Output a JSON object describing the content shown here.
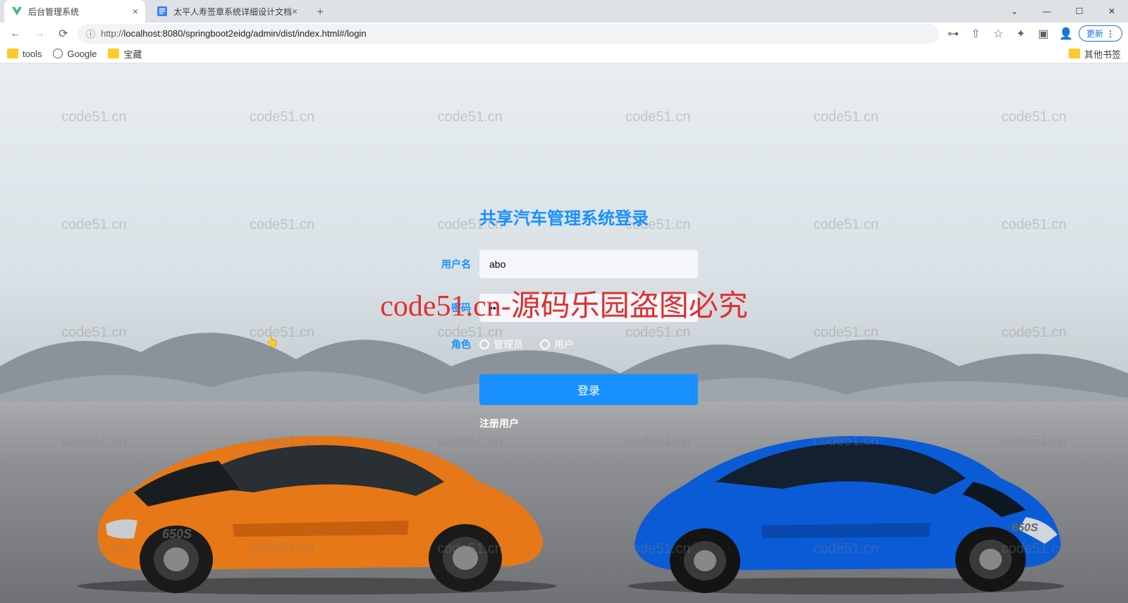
{
  "browser": {
    "tabs": [
      {
        "title": "后台管理系统",
        "active": true
      },
      {
        "title": "太平人寿签章系统详细设计文档",
        "active": false
      }
    ],
    "url_prefix": "http://",
    "url_rest": "localhost:8080/springboot2eidg/admin/dist/index.html#/login",
    "update_label": "更新",
    "bookmarks": {
      "tools": "tools",
      "google": "Google",
      "treasure": "宝藏",
      "other": "其他书签"
    }
  },
  "login": {
    "title": "共享汽车管理系统登录",
    "username_label": "用户名",
    "username_value": "abo",
    "password_label": "密码",
    "password_value": "•••",
    "role_label": "角色",
    "role_admin": "管理员",
    "role_user": "用户",
    "submit": "登录",
    "register": "注册用户"
  },
  "watermark": {
    "small": "code51.cn",
    "big": "code51.cn-源码乐园盗图必究"
  }
}
